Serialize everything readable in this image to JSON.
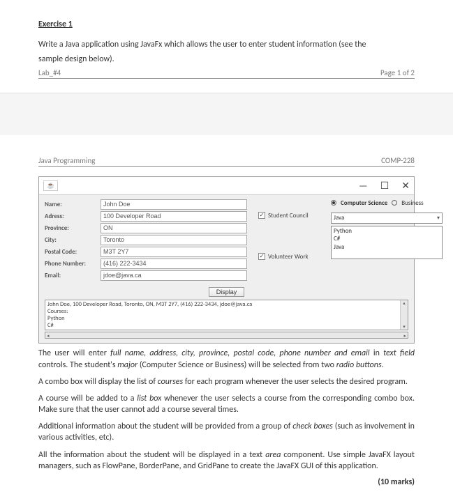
{
  "header": {
    "exercise_title": "Exercise 1",
    "prompt_line1": "Write a Java application using JavaFx which allows the user to enter student information (see the",
    "prompt_line2": "sample design below).",
    "lab_label": "Lab_#4",
    "page_label": "Page 1 of 2"
  },
  "page2_header": {
    "course_name": "Java Programming",
    "course_code": "COMP-228"
  },
  "window": {
    "icon_label": "☕",
    "minimize": "—",
    "maximize": "☐",
    "close": "✕",
    "labels": {
      "name": "Name:",
      "address": "Adress:",
      "province": "Province:",
      "city": "City:",
      "postal": "Postal Code:",
      "phone": "Phone Number:",
      "email": "Email:"
    },
    "values": {
      "name": "John Doe",
      "address": "100 Developer Road",
      "province": "ON",
      "city": "Toronto",
      "postal": "M3T 2Y7",
      "phone": "(416) 222-3434",
      "email": "jdoe@java.ca"
    },
    "radios": {
      "cs": "Computer Science",
      "bus": "Business"
    },
    "checkboxes": {
      "council": "Student Council",
      "volunteer": "Volunteer Work"
    },
    "combo_selected": "Java",
    "list_items": {
      "a": "Python",
      "b": "C#",
      "c": "Java"
    },
    "display_btn": "Display",
    "output": {
      "line1": "John Doe, 100 Developer Road, Toronto, ON, M3T 2Y7, (416) 222-3434, jdoe@java.ca",
      "line2": "Courses:",
      "line3": "Python",
      "line4": "C#"
    }
  },
  "body": {
    "p1a": "The user will enter ",
    "p1b": "full name, address, city, province, postal code, phone number and email",
    "p1c": " in ",
    "p1d": "text field",
    "p1e": " controls. The student's ",
    "p1f": "major",
    "p1g": " (Computer Science or Business) will be selected from two ",
    "p1h": "radio buttons",
    "p1i": ".",
    "p2a": "A combo box will display the list of ",
    "p2b": "courses",
    "p2c": " for each program whenever the user selects the desired program.",
    "p3a": "A course will be added to a ",
    "p3b": "list box",
    "p3c": " whenever the user selects a course from the corresponding combo box. Make sure that the user cannot add a course several times.",
    "p4a": "Additional information about the student will be provided from a group of ",
    "p4b": "check boxes",
    "p4c": " (such as involvement in various activities, etc).",
    "p5a": "All the information about the student will be displayed in a text ",
    "p5b": "area",
    "p5c": " component. Use simple JavaFX layout managers, such as FlowPane, BorderPane, and GridPane to create the JavaFX GUI of this application.",
    "marks": "(10 marks)"
  }
}
